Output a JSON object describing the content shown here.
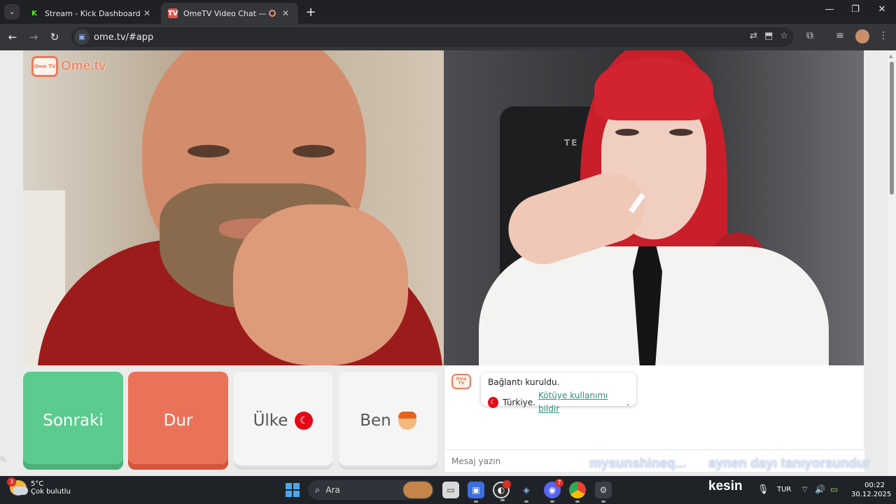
{
  "browser": {
    "tabs": [
      {
        "title": "Stream - Kick Dashboard",
        "favicon": "kick-icon",
        "active": false
      },
      {
        "title": "OmeTV Video Chat — Ome",
        "favicon": "ometv-icon",
        "active": true
      }
    ],
    "url": "ome.tv/#app"
  },
  "page": {
    "logo_text": "Ome.tv",
    "logo_icon_text": "Ome TV",
    "buttons": {
      "next": "Sonraki",
      "stop": "Dur",
      "country": "Ülke",
      "me": "Ben"
    },
    "chat": {
      "connected": "Bağlantı kuruldu.",
      "country": "Türkiye.",
      "report_link": "Kötüye kullanımı bildir",
      "report_suffix": ".",
      "input_placeholder": "Mesaj yazın"
    },
    "overlay": {
      "username": "mysunshineq...",
      "message": "aynen dayı tanıyorsundur"
    },
    "chair_text": "TE BA"
  },
  "taskbar": {
    "weather_temp": "5°C",
    "weather_desc": "Çok bulutlu",
    "weather_badge": "3",
    "search_label": "Ara",
    "discord_badge": "7",
    "overlay_word": "kesin",
    "language": "TUR",
    "time": "00:22",
    "date": "30.12.2025"
  },
  "colors": {
    "next_button": "#5ccb8f",
    "stop_button": "#ea7258",
    "link": "#2f8f7e",
    "ome_orange": "#ef8c6c"
  }
}
